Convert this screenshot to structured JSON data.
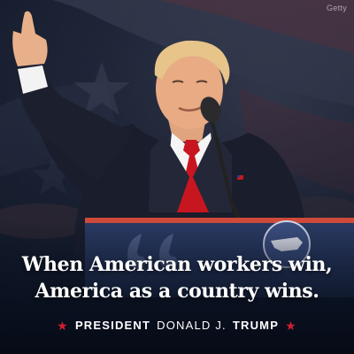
{
  "photo_credit": "Getty",
  "quote": {
    "line1": "When American workers win,",
    "line2": "America as a country wins."
  },
  "attribution": {
    "title": "PRESIDENT",
    "name": "DONALD J.",
    "surname": "TRUMP",
    "star_color": "#d0202f"
  },
  "podium": {
    "seal_icon": "usa-map-seal-icon",
    "quote_mark_icon": "quotation-marks-icon"
  },
  "colors": {
    "background": "#0d1626",
    "suit": "#1a1d2b",
    "tie": "#c7161f",
    "podium": "#2a3a63",
    "text": "#ffffff"
  }
}
